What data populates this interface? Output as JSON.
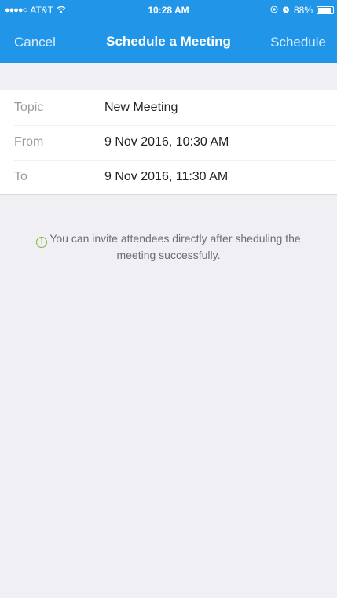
{
  "status_bar": {
    "signal_dots": "●●●●○",
    "carrier": "AT&T",
    "wifi_icon": "wifi-icon",
    "time": "10:28 AM",
    "location_icon": "location-icon",
    "alarm_icon": "alarm-icon",
    "battery_percent": "88%",
    "battery_level": 0.88
  },
  "nav": {
    "cancel_label": "Cancel",
    "title": "Schedule a Meeting",
    "schedule_label": "Schedule",
    "background_color": "#2196e8"
  },
  "form": {
    "rows": [
      {
        "label": "Topic",
        "value": "New Meeting"
      },
      {
        "label": "From",
        "value": "9 Nov 2016, 10:30 AM"
      },
      {
        "label": "To",
        "value": "9 Nov 2016, 11:30 AM"
      }
    ]
  },
  "info": {
    "icon": "info-icon",
    "glyph": "!",
    "text": "You can invite attendees directly after sheduling the meeting successfully."
  }
}
